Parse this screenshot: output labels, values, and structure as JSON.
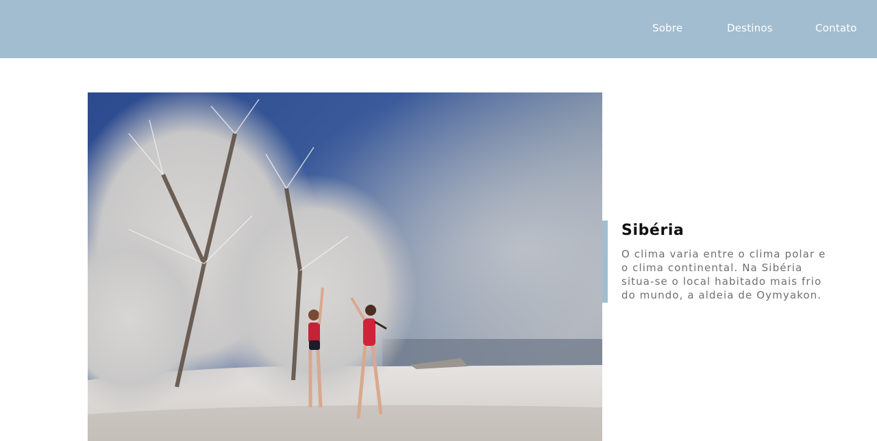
{
  "nav": {
    "items": [
      {
        "label": "Sobre"
      },
      {
        "label": "Destinos"
      },
      {
        "label": "Contato"
      }
    ]
  },
  "destination": {
    "title": "Sibéria",
    "description": "O clima varia entre o clima polar e o clima continental. Na Sibéria situa-se o local habitado mais frio do mundo, a aldeia de Oymyakon."
  },
  "colors": {
    "header": "#a2bdd0",
    "accent": "#a2bdd0",
    "text_muted": "#6f6f6f"
  }
}
